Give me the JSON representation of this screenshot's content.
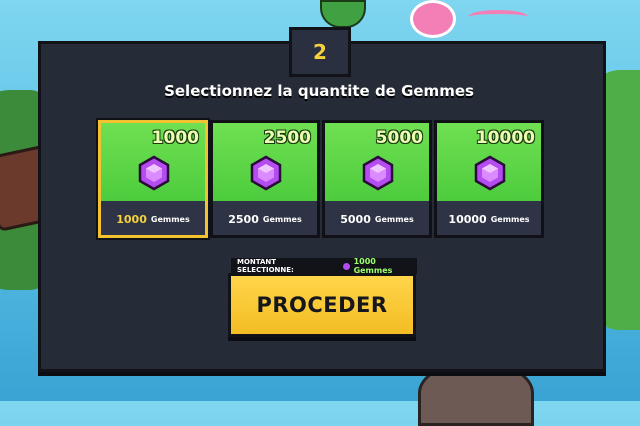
{
  "step": "2",
  "title": "Selectionnez la quantite de Gemmes",
  "options": [
    {
      "amount": "1000",
      "label_num": "1000",
      "label_unit": "Gemmes",
      "selected": true
    },
    {
      "amount": "2500",
      "label_num": "2500",
      "label_unit": "Gemmes",
      "selected": false
    },
    {
      "amount": "5000",
      "label_num": "5000",
      "label_unit": "Gemmes",
      "selected": false
    },
    {
      "amount": "10000",
      "label_num": "10000",
      "label_unit": "Gemmes",
      "selected": false
    }
  ],
  "selected_bar": {
    "label": "MONTANT SELECTIONNE:",
    "value": "1000 Gemmes"
  },
  "proceed_label": "PROCEDER",
  "colors": {
    "panel": "#262b38",
    "card_green": "#4dcc3d",
    "selected_border": "#f2c230",
    "proceed_button": "#f3bd23",
    "gem": "#b44cf0",
    "step_number": "#f6d23a"
  },
  "icons": [
    "gem-icon"
  ]
}
